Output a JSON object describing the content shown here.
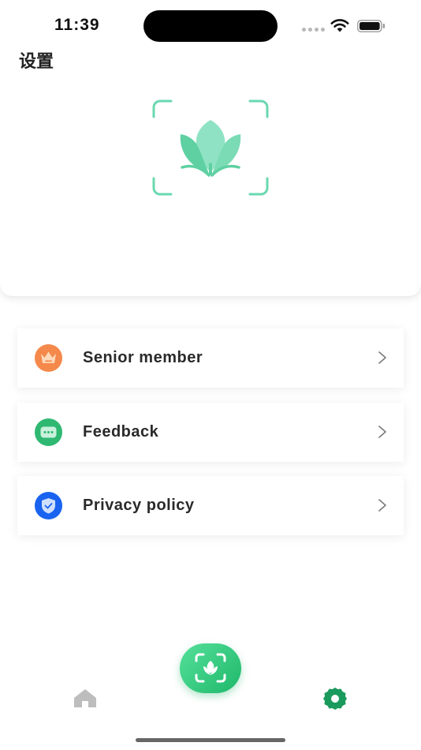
{
  "status_bar": {
    "time": "11:39"
  },
  "page": {
    "title": "设置"
  },
  "menu": {
    "items": [
      {
        "label": "Senior member",
        "icon": "crown-icon",
        "icon_color": "#f4894b"
      },
      {
        "label": "Feedback",
        "icon": "chat-bubble-icon",
        "icon_color": "#2fb872"
      },
      {
        "label": "Privacy policy",
        "icon": "shield-check-icon",
        "icon_color": "#1a63f0"
      }
    ]
  },
  "tab_bar": {
    "tabs": [
      {
        "name": "home",
        "icon": "home-icon",
        "active": false
      },
      {
        "name": "scan",
        "icon": "scan-icon",
        "active": false
      },
      {
        "name": "settings",
        "icon": "gear-icon",
        "active": true
      }
    ]
  },
  "colors": {
    "brand": "#5fd4a6",
    "accent_green": "#1fb86b",
    "inactive_tab": "#bdbdbd",
    "active_tab": "#1a9a5c"
  }
}
